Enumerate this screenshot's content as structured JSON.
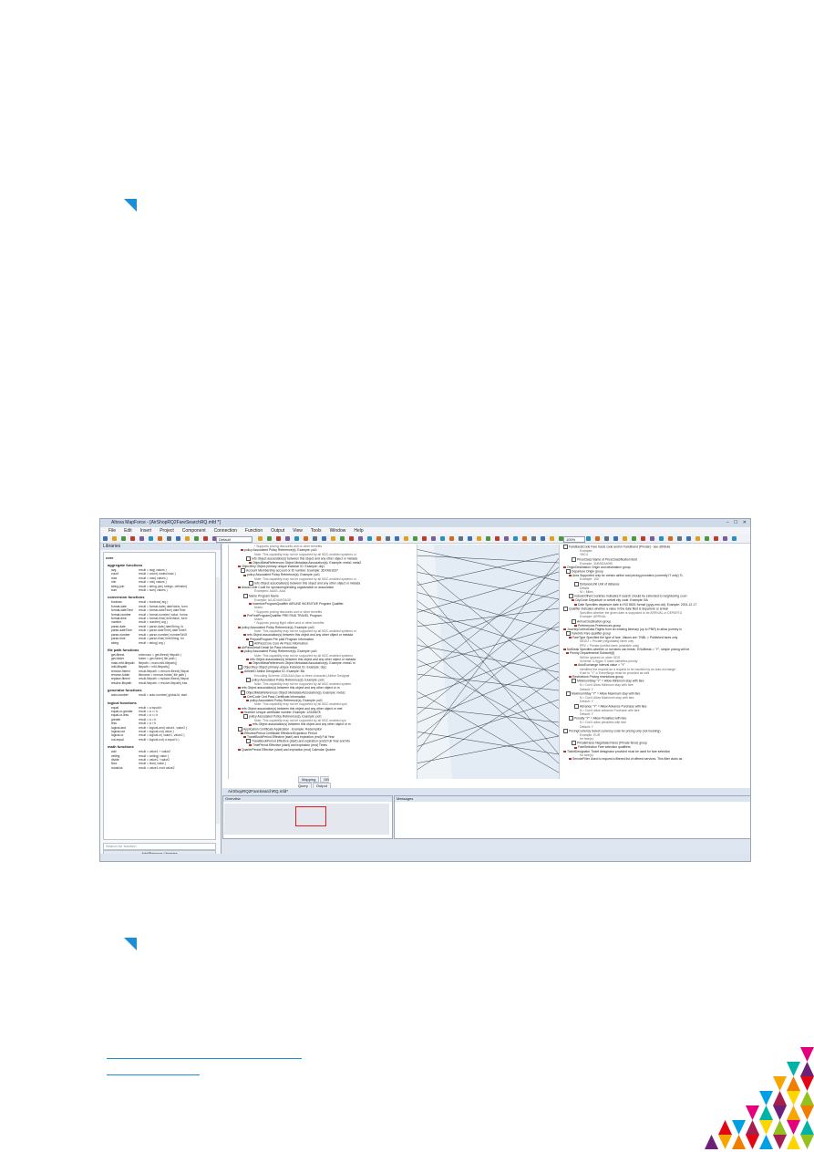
{
  "app": {
    "title": "Altova MapForce - [AirShopRQ2FareSearchRQ.mfd *]",
    "window_controls": "– ☐ ✕",
    "menu": [
      "File",
      "Edit",
      "Insert",
      "Project",
      "Component",
      "Connection",
      "Function",
      "Output",
      "View",
      "Tools",
      "Window",
      "Help"
    ],
    "toolbar": {
      "preset": "Default",
      "zoom": "100%"
    }
  },
  "libraries": {
    "header": "Libraries",
    "root": "core",
    "groups": [
      {
        "name": "aggregate functions",
        "items": [
          [
            "avg",
            "result = avg( values )"
          ],
          [
            "count",
            "result = count( nodes/rows )"
          ],
          [
            "max",
            "result = max( values )"
          ],
          [
            "min",
            "result = min( values )"
          ],
          [
            "string-join",
            "result = string-join( strings, delimiter)"
          ],
          [
            "sum",
            "result = sum( values )"
          ]
        ]
      },
      {
        "name": "conversion functions",
        "items": [
          [
            "boolean",
            "result = boolean( arg )"
          ],
          [
            "format-date",
            "result = format-date( dateValue, form"
          ],
          [
            "format-dateTime",
            "result = format-dateTime( dateTime"
          ],
          [
            "format-number",
            "result = format-number( value, forma"
          ],
          [
            "format-time",
            "result = format-time( timeValue, form"
          ],
          [
            "number",
            "result = number( arg )"
          ],
          [
            "parse-date",
            "result = parse-date( dateString, fo"
          ],
          [
            "parse-dateTime",
            "result = parse-dateTime( dateTimeS"
          ],
          [
            "parse-number",
            "result = parse-number( numberStrOt"
          ],
          [
            "parse-time",
            "result = parse-time( timeString, for"
          ],
          [
            "string",
            "result = string( arg )"
          ]
        ]
      },
      {
        "name": "file path functions",
        "items": [
          [
            "get-fileext",
            "extension = get-fileext( filepath )"
          ],
          [
            "get-folder",
            "folder = get-folder( file path )"
          ],
          [
            "main-mfd-filepath",
            "filepath = main-mfd-filepath()"
          ],
          [
            "mfd-filepath",
            "filepath = mfd-filepath()"
          ],
          [
            "remove-fileext",
            "result-filepath = remove-fileext( filepat"
          ],
          [
            "remove-folder",
            "filename = remove-folder( file path )"
          ],
          [
            "replace-fileext",
            "result-filepath = replace-fileext( filepat"
          ],
          [
            "resolve-filepath",
            "result-filepath = resolve-filepath( bas"
          ]
        ]
      },
      {
        "name": "generator functions",
        "items": [
          [
            "auto-number",
            "result = auto-number( global-id, start"
          ]
        ]
      },
      {
        "name": "logical functions",
        "items": [
          [
            "equal",
            "result = a equal b"
          ],
          [
            "equal-or-greater",
            "result = a >= b"
          ],
          [
            "equal-or-less",
            "result = a <= b"
          ],
          [
            "greater",
            "result = a > b"
          ],
          [
            "less",
            "result = a < b"
          ],
          [
            "logical-and",
            "result = logical-and( value1, value2 )"
          ],
          [
            "logical-not",
            "result = logical-not( value )"
          ],
          [
            "logical-or",
            "result = logical-or( value1, value2 )"
          ],
          [
            "not-equal",
            "result = logical-not( a equal b )"
          ]
        ]
      },
      {
        "name": "math functions",
        "items": [
          [
            "add",
            "result = value1 + value2"
          ],
          [
            "ceiling",
            "result = ceiling( value )"
          ],
          [
            "divide",
            "result = value1 / value2"
          ],
          [
            "floor",
            "result = floor( value )"
          ],
          [
            "modulus",
            "result = value1 mod value2"
          ]
        ]
      }
    ],
    "search_placeholder": "Search for function",
    "add_button": "Add/Remove Libraries",
    "tabs": [
      "Libraries",
      "Project"
    ]
  },
  "mapping": {
    "source_lines": [
      "* Supports pricing discounts and or other benefits",
      "policy Associated Policy Reference(s). Example: pol1",
      "Note: This capability may not be supported by all NDC-enabled systems or",
      "refs Object association(s) between this object and any other object or metada",
      "ObjectMetaReferences Object Metadata Association(s). Example: meta1 meta2",
      "ObjectKey Object primary unique instance ID. Example: obj1",
      "Account Membership account or ID number. Example: 3DXAS1637",
      "policy Associated Policy Reference(s). Example: pol1",
      "Note: This capability may not be supported by all NDC-enabled systems or",
      "refs Object association(s) between this object and any other object or metada",
      "AssocCode Code for sponsoring/ending organization or association",
      "Examples: AAAS, AAA",
      "Name Program Name",
      "Example: AA ADVANTAGE",
      "IncentiveProgramQualifier AIRLINE INCENTIVE Program Qualifier.",
      "Notes:",
      "* Supports pricing discounts and or other benefits",
      "PreFeatProgramQualifier PRE PAID TRAVEL Program.",
      "Notes:",
      "* Supports pricing flight offers and or other benefits",
      "policy Associated Policy Reference(s). Example: pol1",
      "Note: This capability may not be supported by all NDC-enabled systems or",
      "refs Object association(s) between this object and any other object or metada",
      "PrepaidProgram Pre paid Program Information",
      "AirPassCore Core Air Pass Information",
      "AirPassDetail Detail Air Pass Information",
      "policy Associated Policy Reference(s). Example: pol1",
      "Note: This capability may not be supported by all NDC-enabled systems",
      "refs Object association(s) between this object and any other object or metada",
      "ObjectMetaReferences Object Metadata Association(s). Example: meta1 m",
      "ObjectKey Object primary unique instance ID. Example: obj1",
      "AirlineID Airline Designator ID. Example: BA",
      "Encoding Scheme: IATA/A4A (two or three character) Airline Designat",
      "policy Associated Policy Reference(s). Example: pol1",
      "Note: This capability may not be supported by all NDC-enabled system",
      "refs Object association(s) between this object and any other object or m",
      "ObjectMetaReferences Object Metadata Association(s). Example: meta1",
      "CertCode Cert Pass Certificate information",
      "policy Associated Policy Reference(s). Example: pol1",
      "Note: This capability may not be supported by all NDC-enabled syst",
      "refs Object association(s) between this object and any other object or met",
      "Number Unique certificate number. Example: 12345678",
      "policy Associated Policy Reference(s). Example: pol1",
      "Note: This capability may not be supported by all NDC-enabled sys",
      "refs Object association(s) between this object and any other object or m",
      "Application Certificate Application . Example: Redemption",
      "EffectivePeriod Certificate Effective/Expiration Period",
      "TravelBookPeriod Effective (start) and expiration (end) Full Year",
      "TravelBookPeriod Effective (start) and expiration (end) Full Year and Mo",
      "TimePeriod Effective (start) and expiration (end) Times",
      "QuarterPeriod Effective (start) and expiration (end) Calendar Quarter"
    ],
    "target_lines": [
      "FareBasisCode Fare basis code and/or FareBrand (Private) - see attribute",
      "Example:",
      "YBC4",
      "PriceClass Name of PriceClassification field",
      "Example: 3UBSDA4050",
      "OriginDestination Origin and destination group.",
      "Departure Origin group",
      "Area Supported only for certain airline and pricing providers (currently IT only) TL",
      "Example: 100",
      "DistanceUnit Unit of distance",
      "Details",
      "M = Miles",
      "IncludeOtherCountries Indicates if search should be extended to neighboring coun",
      "CityCode Departure or arrival city code. Example: BA",
      "Date Specifies departure date in ISO 8601 format (yyyy-mm-dd). Example: 2001-12-17",
      "Qualifier Indicates whether a value in the date field is departure or arrival",
      "Specifies whether the given date is supposed to be ARRIVAL or DEPARTU",
      "Example: ARRIVAL",
      "Arrival Destination group",
      "Preferences Preferences group",
      "JourneyControlData Flights from an existing itinerary (up to PNR) to allow journey lo",
      "FareInfo Fare qualifier group",
      "FareType Specified the type of fare. Values are: TNBL = Published fares only",
      "NEGO = Private (negotiated) fares only",
      "PRV = Private (unfiled fares (sharable only)",
      "NoBreak Specifies whether or not fares can break. If NoBreak = \"Y\", simple pricing will be",
      "Priority Departmental Subscrib[t]",
      "Will be ignored on other GDS",
      "Scheme: 0-9(giw. 0 lower identifies priority",
      "AutoExchange Interval value = \"Y\"",
      "Identifies the request as a request to be handled by an auto-exchange",
      "If set to \"Y\" a TravelNego must be provided as well",
      "Restrictions Pricing restrictions group",
      "MinimumStay \"Y\" = Allow Minimum stay with fare",
      "N = Don't Allow Minimum stay with fare",
      "Default: Y",
      "MaximumStay \"Y\" = Allow Maximum stay with fare",
      "N = Don't Allow Maximum stay with fare",
      "Default: Y",
      "Advance \"Y\" = Allow Advance Purchase with fare",
      "N = Don't allow advance Purchase with fare",
      "Default: Y",
      "Penalty \"Y\" = Allow Penalties with fare",
      "N = Don't allow penalties with fare",
      "Default: Y",
      "PricingCurrency Select currency code for pricing only (not booking)",
      "Example: EUR",
      "for fare(s)",
      "PrivateFares Negotiated fares (Private fares) group",
      "FareSelection Fare selection qualifiers",
      "TicketDesignator Ticket designator provided must be used for fare selection",
      "for fare(s)",
      "ServiceFilter Used to request a filtered list of offered services. This filter clubs as"
    ],
    "bottom_tabs": [
      "Mapping",
      "DB Query",
      "Output"
    ],
    "document_tab": "AirShopRQ2FareSearchRQ.mfd*",
    "overview_header": "Overview",
    "messages_header": "Messages"
  }
}
